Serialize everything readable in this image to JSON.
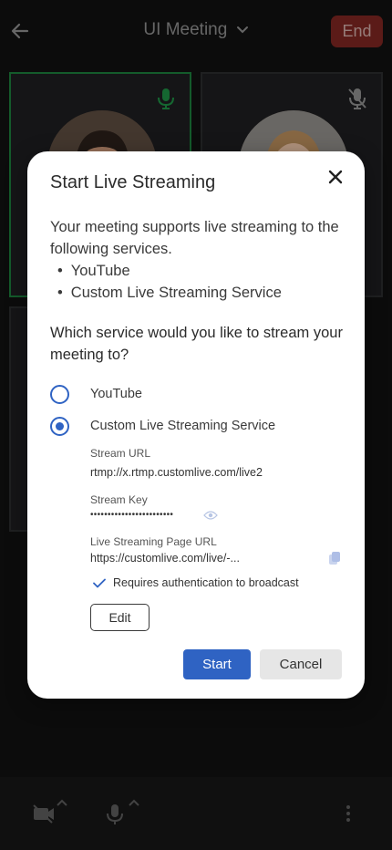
{
  "header": {
    "title": "UI Meeting",
    "end_label": "End"
  },
  "dialog": {
    "title": "Start Live Streaming",
    "intro": "Your meeting supports live streaming to the following services.",
    "services": [
      "YouTube",
      "Custom Live Streaming Service"
    ],
    "question": "Which service would you like to stream your meeting to?",
    "options": [
      {
        "label": "YouTube",
        "selected": false
      },
      {
        "label": "Custom Live Streaming Service",
        "selected": true
      }
    ],
    "stream_url_label": "Stream URL",
    "stream_url_value": "rtmp://x.rtmp.customlive.com/live2",
    "stream_key_label": "Stream Key",
    "stream_key_value": "••••••••••••••••••••••••",
    "page_url_label": "Live Streaming Page URL",
    "page_url_value": "https://customlive.com/live/-...",
    "auth_text": "Requires authentication to broadcast",
    "edit_label": "Edit",
    "start_label": "Start",
    "cancel_label": "Cancel"
  },
  "colors": {
    "accent": "#2f63c3",
    "end_button": "#7a2520",
    "active_speaker": "#1b7a3a",
    "background": "#111111"
  },
  "icons": [
    "arrow-left-icon",
    "chevron-down-icon",
    "mic-icon",
    "mic-off-icon",
    "close-icon",
    "eye-icon",
    "copy-icon",
    "check-icon",
    "camera-off-icon",
    "caret-up-icon",
    "more-vertical-icon"
  ]
}
